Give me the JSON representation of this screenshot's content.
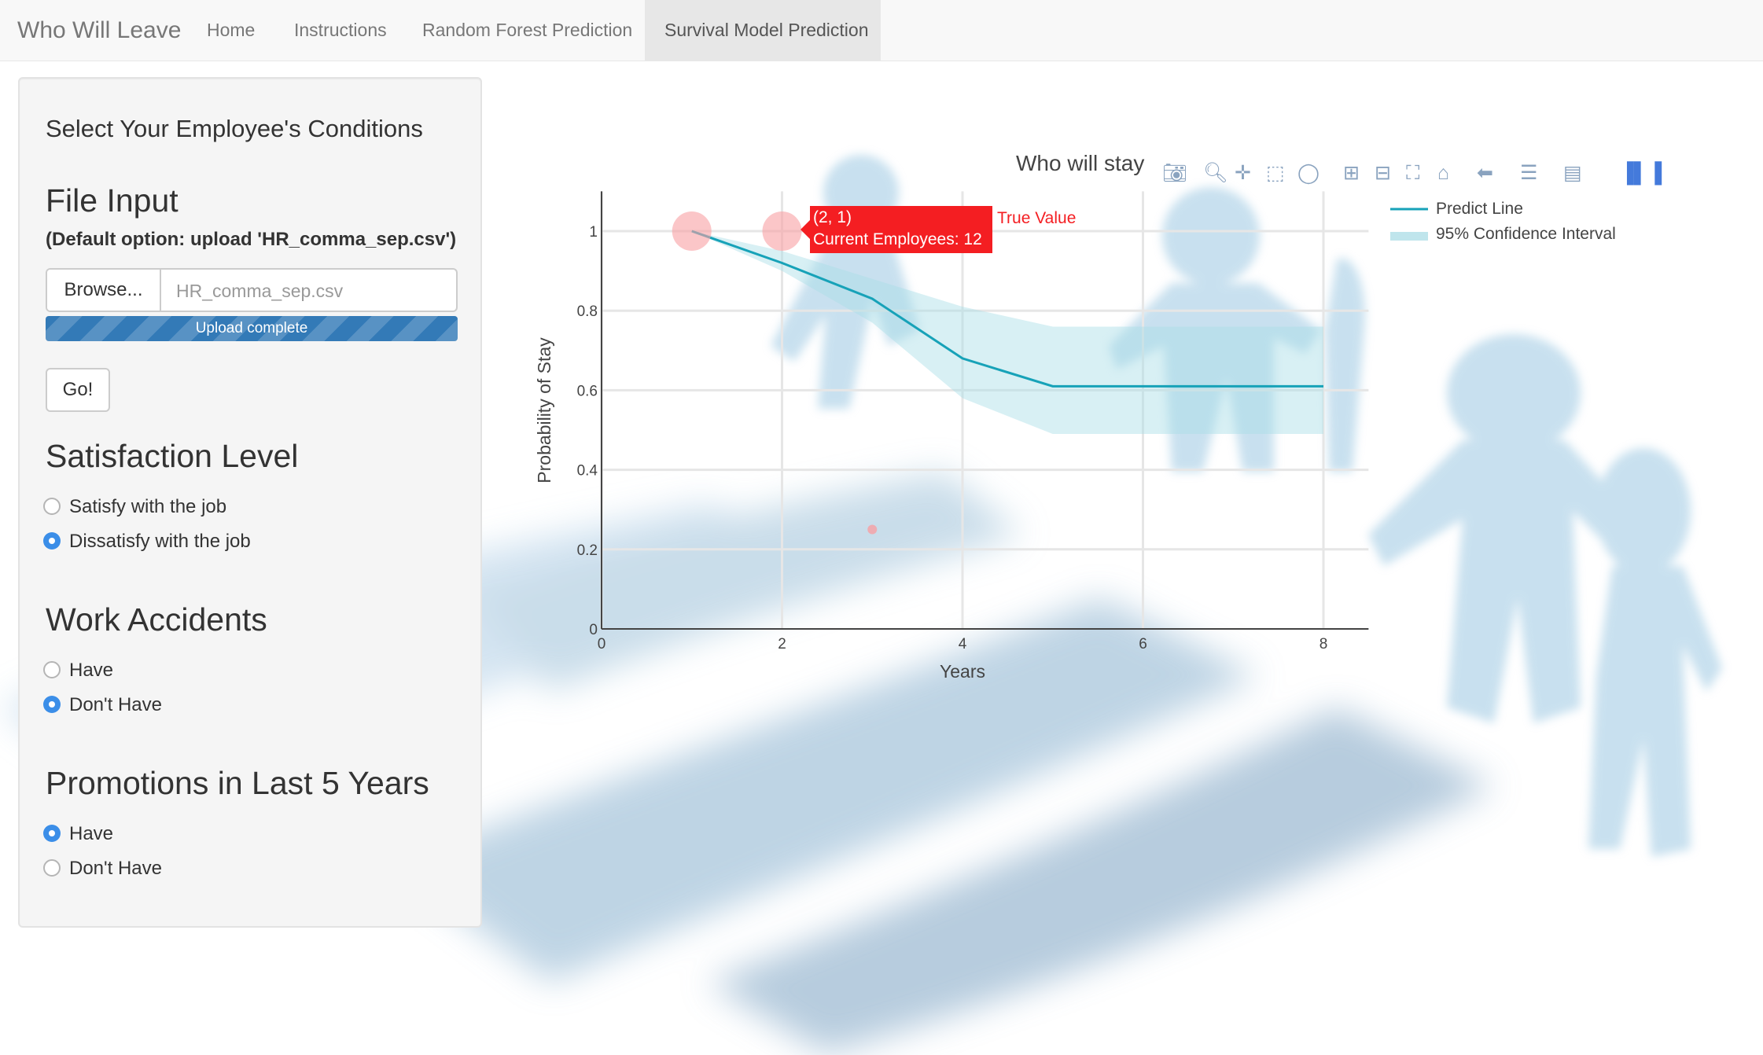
{
  "navbar": {
    "brand": "Who Will Leave",
    "tabs": [
      {
        "label": "Home",
        "active": false
      },
      {
        "label": "Instructions",
        "active": false
      },
      {
        "label": "Random Forest Prediction",
        "active": false
      },
      {
        "label": "Survival Model Prediction",
        "active": true
      }
    ]
  },
  "sidebar": {
    "heading": "Select Your Employee's Conditions",
    "file_input": {
      "title": "File Input",
      "note": "(Default option: upload 'HR_comma_sep.csv')",
      "browse_label": "Browse...",
      "file_name": "HR_comma_sep.csv",
      "progress_label": "Upload complete",
      "progress": 1.0
    },
    "go_label": "Go!",
    "satisfaction": {
      "title": "Satisfaction Level",
      "options": [
        "Satisfy with the job",
        "Dissatisfy with the job"
      ],
      "selected": 1
    },
    "accidents": {
      "title": "Work Accidents",
      "options": [
        "Have",
        "Don't Have"
      ],
      "selected": 1
    },
    "promotions": {
      "title": "Promotions in Last 5 Years",
      "options": [
        "Have",
        "Don't Have"
      ],
      "selected": 0
    }
  },
  "chart_data": {
    "type": "line",
    "title": "Who will stay",
    "xlabel": "Years",
    "ylabel": "Probability of Stay",
    "xlim": [
      0,
      8.5
    ],
    "ylim": [
      0,
      1.1
    ],
    "x_ticks": [
      "0",
      "2",
      "4",
      "6",
      "8"
    ],
    "y_ticks": [
      "0",
      "0.2",
      "0.4",
      "0.6",
      "0.8",
      "1"
    ],
    "grid": true,
    "legend_position": "top-right",
    "series": [
      {
        "name": "Predict Line",
        "x": [
          1,
          2,
          3,
          4,
          5,
          6,
          7,
          8
        ],
        "y": [
          1.0,
          0.92,
          0.83,
          0.68,
          0.61,
          0.61,
          0.61,
          0.61
        ],
        "color": "#17a2b8"
      },
      {
        "name": "95% Confidence Interval",
        "x": [
          1,
          2,
          3,
          4,
          5,
          6,
          7,
          8
        ],
        "upper": [
          1.0,
          0.95,
          0.88,
          0.81,
          0.76,
          0.76,
          0.76,
          0.76
        ],
        "lower": [
          1.0,
          0.9,
          0.77,
          0.58,
          0.49,
          0.49,
          0.49,
          0.49
        ],
        "color": "#a8dde6"
      },
      {
        "name": "True Value",
        "x": [
          1,
          2,
          3
        ],
        "y": [
          1.0,
          1.0,
          0.25
        ],
        "color": "#f8a0a4"
      }
    ],
    "hover": {
      "point": "(2, 1)",
      "detail": "Current Employees: 12",
      "series": "True Value"
    }
  },
  "modebar": {
    "icons": [
      "camera-icon",
      "zoom-icon",
      "pan-icon",
      "box-select-icon",
      "lasso-icon",
      "zoom-in-icon",
      "zoom-out-icon",
      "autoscale-icon",
      "reset-axes-icon",
      "hover-closest-icon",
      "hover-compare-icon",
      "toggle-spikelines-icon",
      "plotly-logo-icon"
    ]
  }
}
